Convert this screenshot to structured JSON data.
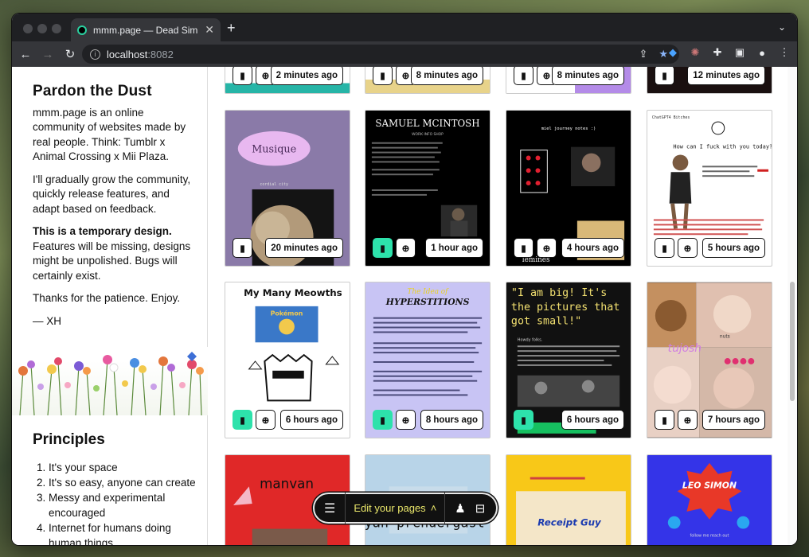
{
  "browser": {
    "tab_title": "mmm.page — Dead Simple, Dr",
    "url_host": "localhost",
    "url_port": ":8082"
  },
  "sidebar": {
    "title": "Pardon the Dust",
    "p1": "mmm.page is an online community of websites made by real people. Think: Tumblr x Animal Crossing x Mii Plaza.",
    "p2": "I'll gradually grow the community, quickly release features, and adapt based on feedback.",
    "p3_bold": "This is a temporary design.",
    "p3_rest": " Features will be missing, designs might be unpolished. Bugs will certainly exist.",
    "p4": "Thanks for the patience. Enjoy.",
    "sign": "— XH",
    "principles_title": "Principles",
    "principles": [
      "It's your space",
      "It's so easy, anyone can create",
      "Messy and experimental encouraged",
      "Internet for humans doing human things"
    ]
  },
  "cards": [
    {
      "time": "2 minutes ago",
      "bookmarked": false
    },
    {
      "time": "8 minutes ago",
      "bookmarked": false
    },
    {
      "time": "8 minutes ago",
      "bookmarked": false
    },
    {
      "time": "12 minutes ago",
      "bookmarked": false
    },
    {
      "time": "20 minutes ago",
      "bookmarked": false,
      "label": "Musique",
      "sub": "cordial city"
    },
    {
      "time": "1 hour ago",
      "bookmarked": true,
      "label": "SAMUEL MCINTOSH",
      "sub": "WORK    INFO    SHOP"
    },
    {
      "time": "4 hours ago",
      "bookmarked": false,
      "label": "miel journey notes :)",
      "sub": "lemines"
    },
    {
      "time": "5 hours ago",
      "bookmarked": false,
      "label": "How can I fuck with you today?",
      "sub": "ChatGPT4 Bitches"
    },
    {
      "time": "6 hours ago",
      "bookmarked": true,
      "label": "My Many Meowths",
      "sub": "Pokémon"
    },
    {
      "time": "8 hours ago",
      "bookmarked": true,
      "label": "HYPERSTITIONS",
      "sub": "The Idea of"
    },
    {
      "time": "6 hours ago",
      "bookmarked": true,
      "label": "\"I am big! It's the pictures that got small!\"",
      "sub": "Howdy folks."
    },
    {
      "time": "7 hours ago",
      "bookmarked": false,
      "label": "tujosh",
      "sub": "nuts"
    },
    {
      "time": "",
      "bookmarked": false,
      "label": "manvan"
    },
    {
      "time": "",
      "bookmarked": false,
      "label": "ryan prendergast"
    },
    {
      "time": "",
      "bookmarked": false,
      "label": "Receipt Guy"
    },
    {
      "time": "",
      "bookmarked": false,
      "label": "LEO SIMON",
      "sub": "follow me    reach out"
    }
  ],
  "dock": {
    "edit_label": "Edit your pages"
  },
  "colors": {
    "accent": "#2de2ab",
    "dock_text": "#e9e66a"
  }
}
